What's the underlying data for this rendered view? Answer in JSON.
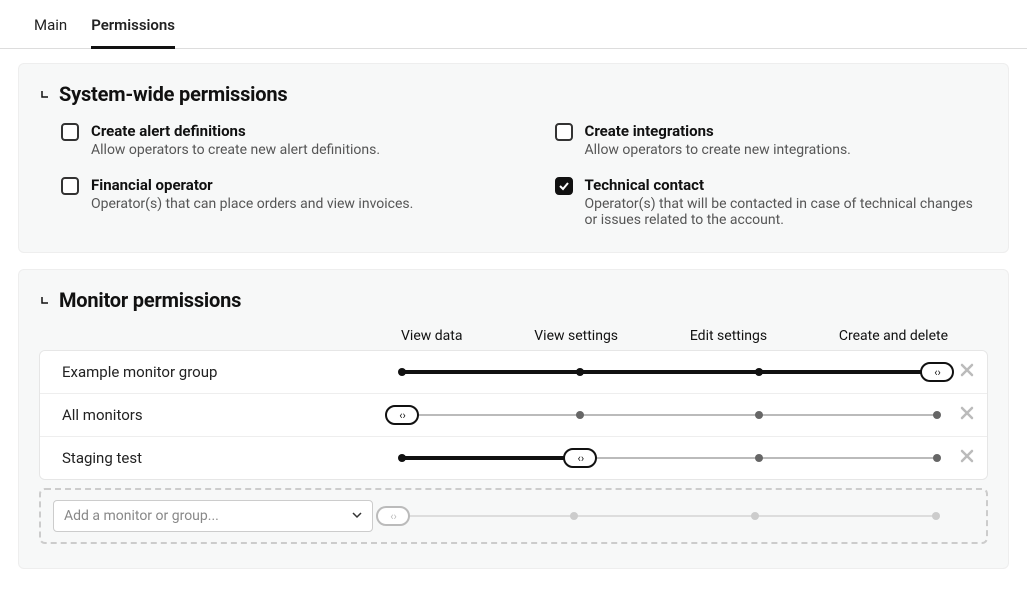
{
  "tabs": {
    "main": "Main",
    "permissions": "Permissions"
  },
  "system_section": {
    "title": "System-wide permissions",
    "items": {
      "create_alerts": {
        "label": "Create alert definitions",
        "desc": "Allow operators to create new alert definitions.",
        "checked": false
      },
      "create_integrations": {
        "label": "Create integrations",
        "desc": "Allow operators to create new integrations.",
        "checked": false
      },
      "financial_operator": {
        "label": "Financial operator",
        "desc": "Operator(s) that can place orders and view invoices.",
        "checked": false
      },
      "technical_contact": {
        "label": "Technical contact",
        "desc": "Operator(s) that will be contacted in case of technical changes or issues related to the account.",
        "checked": true
      }
    }
  },
  "monitor_section": {
    "title": "Monitor permissions",
    "headers": {
      "view_data": "View data",
      "view_settings": "View settings",
      "edit_settings": "Edit settings",
      "create_delete": "Create and delete"
    },
    "rows": [
      {
        "name": "Example monitor group",
        "level": 3
      },
      {
        "name": "All monitors",
        "level": 0
      },
      {
        "name": "Staging test",
        "level": 1
      }
    ],
    "add_placeholder": "Add a monitor or group..."
  }
}
